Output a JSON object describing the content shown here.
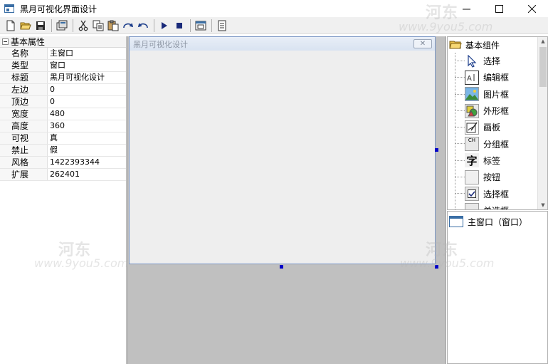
{
  "window": {
    "title": "黑月可视化界面设计",
    "minimize": "—",
    "maximize": "☐",
    "close": "✕"
  },
  "toolbar": {
    "buttons": [
      "new-file-icon",
      "open-folder-icon",
      "save-icon",
      "properties-icon",
      "cut-icon",
      "copy-icon",
      "paste-icon",
      "redo-icon",
      "undo-icon",
      "run-icon",
      "stop-icon",
      "window-preview-icon",
      "notes-icon"
    ]
  },
  "properties": {
    "header": "基本属性",
    "rows": [
      {
        "name": "名称",
        "value": "主窗口"
      },
      {
        "name": "类型",
        "value": "窗口"
      },
      {
        "name": "标题",
        "value": "黑月可视化设计"
      },
      {
        "name": "左边",
        "value": "0"
      },
      {
        "name": "顶边",
        "value": "0"
      },
      {
        "name": "宽度",
        "value": "480"
      },
      {
        "name": "高度",
        "value": "360"
      },
      {
        "name": "可视",
        "value": "真"
      },
      {
        "name": "禁止",
        "value": "假"
      },
      {
        "name": "风格",
        "value": "1422393344"
      },
      {
        "name": "扩展",
        "value": "262401"
      }
    ]
  },
  "design": {
    "form_title": "黑月可视化设计",
    "form_close": "✕"
  },
  "palette": {
    "header": "基本组件",
    "items": [
      {
        "label": "选择",
        "icon": "pointer-icon"
      },
      {
        "label": "编辑框",
        "icon": "edit-box-icon"
      },
      {
        "label": "图片框",
        "icon": "picture-box-icon"
      },
      {
        "label": "外形框",
        "icon": "shape-box-icon"
      },
      {
        "label": "画板",
        "icon": "drawing-board-icon"
      },
      {
        "label": "分组框",
        "icon": "group-box-icon"
      },
      {
        "label": "标签",
        "icon": "label-icon"
      },
      {
        "label": "按钮",
        "icon": "button-icon"
      },
      {
        "label": "选择框",
        "icon": "checkbox-icon"
      },
      {
        "label": "单选框",
        "icon": "radio-icon"
      }
    ]
  },
  "tree": {
    "items": [
      {
        "label": "主窗口（窗口）"
      }
    ]
  },
  "watermark": {
    "logo": "河东",
    "url": "www.9you5.com"
  },
  "colors": {
    "accent": "#3a6ea5",
    "design_bg": "#c0c0c0",
    "handle": "#0000c8"
  }
}
